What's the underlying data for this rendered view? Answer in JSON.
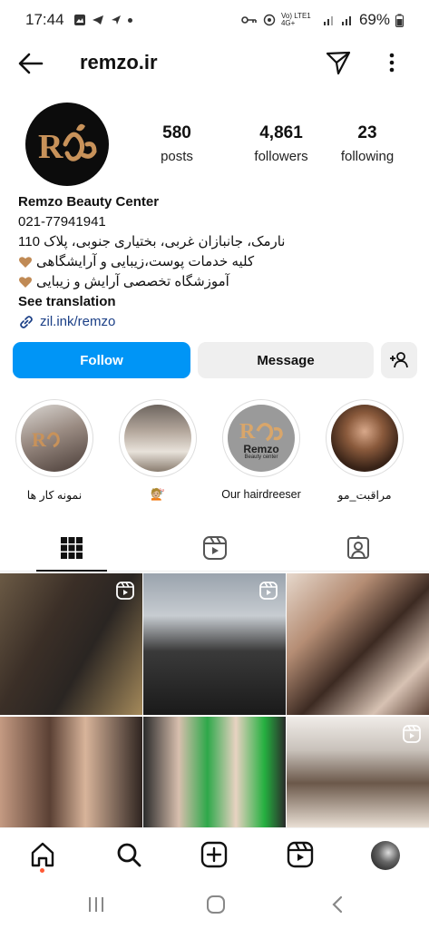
{
  "status_bar": {
    "time": "17:44",
    "network": "Vo) LTE1 4G+",
    "battery": "69%"
  },
  "header": {
    "username": "remzo.ir"
  },
  "profile": {
    "stats": [
      {
        "value": "580",
        "label": "posts"
      },
      {
        "value": "4,861",
        "label": "followers"
      },
      {
        "value": "23",
        "label": "following"
      }
    ],
    "name": "Remzo Beauty Center",
    "phone": "021-77941941",
    "address": "نارمک، جانبازان غربی، بختیاری جنوبی، پلاک 110",
    "line2": "کلیه خدمات پوست،زیبایی و آرایشگاهی",
    "line3": "آموزشگاه تخصصی آرایش و زیبایی",
    "see_translation": "See translation",
    "link": "zil.ink/remzo"
  },
  "buttons": {
    "follow": "Follow",
    "message": "Message"
  },
  "highlights": [
    {
      "caption": "نمونه کار ها"
    },
    {
      "caption": "💇🏼"
    },
    {
      "caption": "Our hairdreeser"
    },
    {
      "caption": "مراقبت_مو"
    }
  ],
  "avatar_logo_text": "Remzo",
  "highlight_logo": {
    "title": "Remzo",
    "subtitle": "Beauty center"
  },
  "colors": {
    "follow_blue": "#0095f6",
    "link_blue": "#1b3f86",
    "logo_gold": "#c8925a"
  }
}
